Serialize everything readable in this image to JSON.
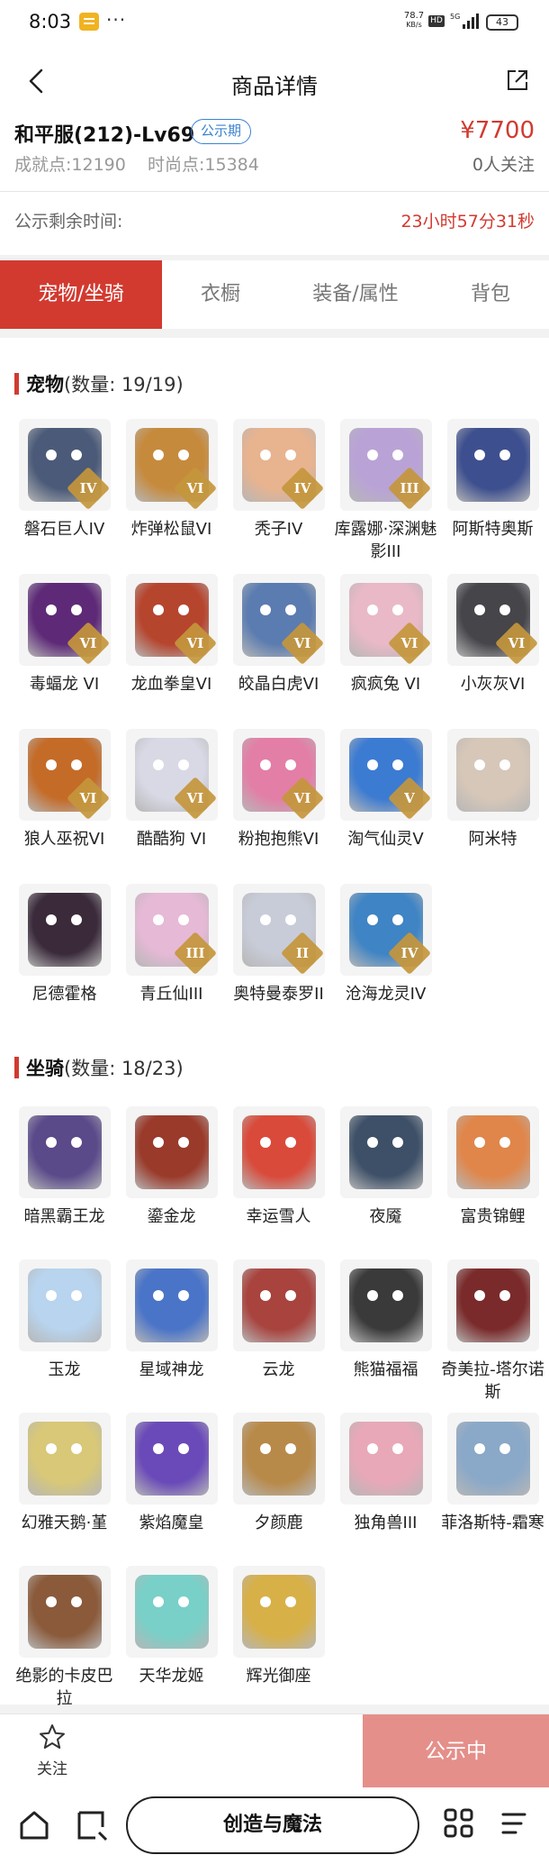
{
  "status_bar": {
    "time": "8:03",
    "dots": "···",
    "net_speed_value": "78.7",
    "net_speed_unit": "KB/s",
    "hd": "HD",
    "network": "5G",
    "battery": "43"
  },
  "nav": {
    "title": "商品详情"
  },
  "product": {
    "name": "和平服(212)-Lv69",
    "status_badge": "公示期",
    "price": "¥7700",
    "achievement": "成就点:12190",
    "fashion": "时尚点:15384",
    "followers": "0人关注"
  },
  "countdown": {
    "label": "公示剩余时间:",
    "value": "23小时57分31秒"
  },
  "tabs": [
    {
      "label": "宠物/坐骑",
      "active": true
    },
    {
      "label": "衣橱",
      "active": false
    },
    {
      "label": "装备/属性",
      "active": false
    },
    {
      "label": "背包",
      "active": false
    }
  ],
  "pets": {
    "title": "宠物",
    "count": "(数量: 19/19)",
    "items": [
      {
        "name": "磐石巨人IV",
        "tier": "IV",
        "color": "#4a5a78"
      },
      {
        "name": "炸弹松鼠VI",
        "tier": "VI",
        "color": "#c68a3c"
      },
      {
        "name": "秃子IV",
        "tier": "IV",
        "color": "#e8b38f"
      },
      {
        "name": "库露娜·深渊魅影III",
        "tier": "III",
        "color": "#b9a3d6"
      },
      {
        "name": "阿斯特奥斯",
        "tier": "",
        "color": "#3d4f8e"
      },
      {
        "name": "毒蝠龙 VI",
        "tier": "VI",
        "color": "#5e2a78"
      },
      {
        "name": "龙血拳皇VI",
        "tier": "VI",
        "color": "#b6452e"
      },
      {
        "name": "皎晶白虎VI",
        "tier": "VI",
        "color": "#5b7cb0"
      },
      {
        "name": "疯疯兔 VI",
        "tier": "VI",
        "color": "#e9b9c7"
      },
      {
        "name": "小灰灰VI",
        "tier": "VI",
        "color": "#45454a"
      },
      {
        "name": "狼人巫祝VI",
        "tier": "VI",
        "color": "#c46b28"
      },
      {
        "name": "酷酷狗 VI",
        "tier": "VI",
        "color": "#d9d9e6"
      },
      {
        "name": "粉抱抱熊VI",
        "tier": "VI",
        "color": "#e37ea6"
      },
      {
        "name": "淘气仙灵V",
        "tier": "V",
        "color": "#3c7bd2"
      },
      {
        "name": "阿米特",
        "tier": "",
        "color": "#d6c7b8"
      },
      {
        "name": "尼德霍格",
        "tier": "",
        "color": "#3a2a3a"
      },
      {
        "name": "青丘仙III",
        "tier": "III",
        "color": "#e6b9d6"
      },
      {
        "name": "奥特曼泰罗II",
        "tier": "II",
        "color": "#c8ccd8"
      },
      {
        "name": "沧海龙灵IV",
        "tier": "IV",
        "color": "#3f84c4"
      }
    ]
  },
  "mounts": {
    "title": "坐骑",
    "count": "(数量: 18/23)",
    "items": [
      {
        "name": "暗黑霸王龙",
        "color": "#5a4a8a"
      },
      {
        "name": "鎏金龙",
        "color": "#9a3a2a"
      },
      {
        "name": "幸运雪人",
        "color": "#d94a3a"
      },
      {
        "name": "夜魇",
        "color": "#3e5068"
      },
      {
        "name": "富贵锦鲤",
        "color": "#e0864a"
      },
      {
        "name": "玉龙",
        "color": "#b8d4ee"
      },
      {
        "name": "星域神龙",
        "color": "#4a74c8"
      },
      {
        "name": "云龙",
        "color": "#a8433e"
      },
      {
        "name": "熊猫福福",
        "color": "#3a3a3a"
      },
      {
        "name": "奇美拉-塔尔诺斯",
        "color": "#7a2a2a"
      },
      {
        "name": "幻雅天鹅·堇",
        "color": "#d8c878"
      },
      {
        "name": "紫焰魔皇",
        "color": "#6a4ab8"
      },
      {
        "name": "夕颜鹿",
        "color": "#b88a4a"
      },
      {
        "name": "独角兽III",
        "color": "#e8a8b8"
      },
      {
        "name": "菲洛斯特-霜寒",
        "color": "#8aa8c8"
      },
      {
        "name": "绝影的卡皮巴拉",
        "color": "#8a5a3a"
      },
      {
        "name": "天华龙姬",
        "color": "#78d0c8"
      },
      {
        "name": "辉光御座",
        "color": "#d8b048"
      }
    ]
  },
  "bottom": {
    "follow_label": "关注",
    "cta_label": "公示中"
  },
  "sysnav": {
    "center_label": "创造与魔法"
  },
  "colors": {
    "accent": "#d23a30",
    "badge_blue": "#3a83d0",
    "cta_disabled": "#e58f8a"
  }
}
